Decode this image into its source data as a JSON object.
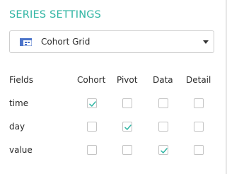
{
  "section_title": "SERIES SETTINGS",
  "visualization": {
    "selected_label": "Cohort Grid",
    "icon": "grid-icon"
  },
  "table": {
    "headers": {
      "fields": "Fields",
      "cohort": "Cohort",
      "pivot": "Pivot",
      "data": "Data",
      "detail": "Detail"
    },
    "rows": [
      {
        "field": "time",
        "cohort": true,
        "pivot": false,
        "data": false,
        "detail": false
      },
      {
        "field": "day",
        "cohort": false,
        "pivot": true,
        "data": false,
        "detail": false
      },
      {
        "field": "value",
        "cohort": false,
        "pivot": false,
        "data": true,
        "detail": false
      }
    ]
  },
  "colors": {
    "accent": "#2fb5a3",
    "icon_blue": "#4b73c9",
    "checkbox_border": "#c4c4c4",
    "text": "#2b2b2b"
  }
}
